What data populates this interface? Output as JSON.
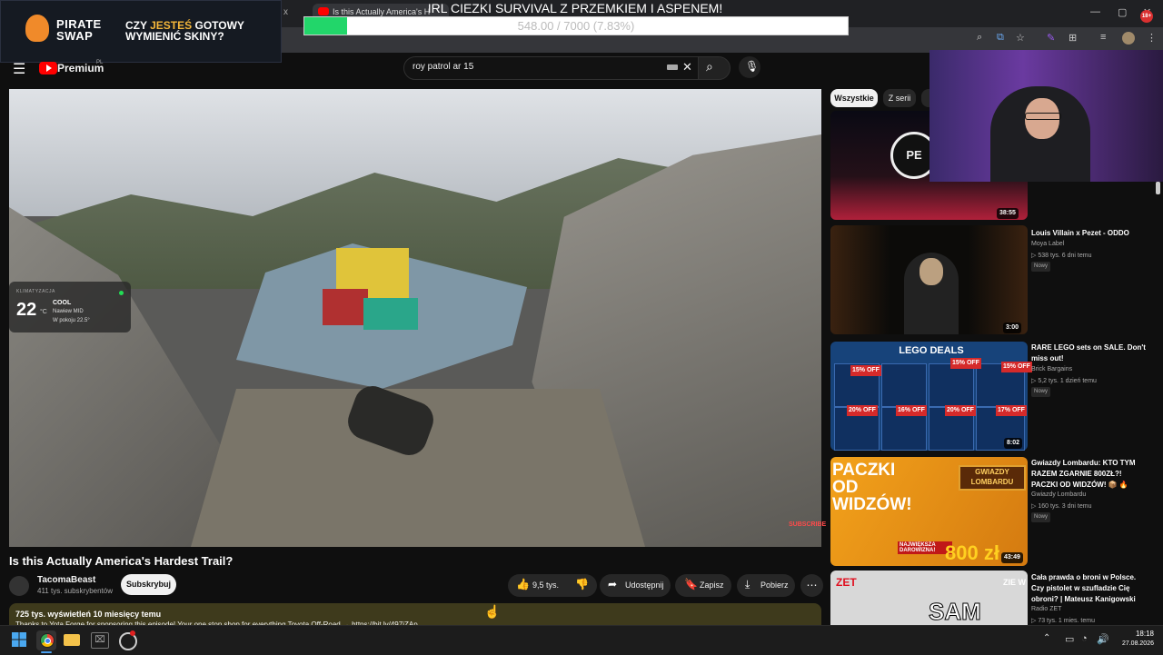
{
  "browser": {
    "tab_title": "Is this Actually America's H",
    "tab_close_left": "x",
    "window_controls": {
      "minimize": "—",
      "maximize": "▢",
      "close": "✕"
    },
    "toolbar_icons": [
      "zoom-icon",
      "install-icon",
      "bookmark-star-icon",
      "extension-icon",
      "puzzle-icon",
      "queue-icon",
      "profile-icon",
      "menu-dots-icon"
    ]
  },
  "overlay": {
    "pirate_brand": "PIRATE SWAP",
    "pirate_slogan_pre": "CZY ",
    "pirate_slogan_hl": "JESTEŚ",
    "pirate_slogan_post": " GOTOWY WYMIENIĆ SKINY?",
    "goal_title": "IRL CIEZKI SURVIVAL Z PRZEMKIEM I ASPENEM!",
    "goal_text": "548.00 / 7000 (7.83%)",
    "goal_fraction": 0.0783,
    "notification_badge": "18+"
  },
  "header": {
    "brand": "Premium",
    "brand_sup": "PL",
    "search_value": "roy patrol ar 15"
  },
  "player": {
    "climate": {
      "label": "KLIMATYZACJA",
      "temp": "22",
      "unit": "°C",
      "mode": "COOL",
      "fan": "Nawiew MID",
      "room": "W pokoju 22.5°"
    },
    "watermark": "SUBSCRIBE"
  },
  "video": {
    "title": "Is this Actually America's Hardest Trail?",
    "channel": "TacomaBeast",
    "subs": "411 tys. subskrybentów",
    "subscribe_label": "Subskrybuj",
    "likes": "9,5 tys.",
    "share_label": "Udostępnij",
    "save_label": "Zapisz",
    "download_label": "Pobierz",
    "more_label": "⋯",
    "views": "725 tys. wyświetleń  10 miesięcy temu",
    "description": "Thanks to Yota Forge for sponsoring this episode! Your one stop shop for everything Toyota Off-Road → https://bit.ly/497iZAp"
  },
  "chips": {
    "all": "Wszystkie",
    "series": "Z serii"
  },
  "sidebar": [
    {
      "duration": "38:55",
      "thumb_text": "PE"
    },
    {
      "duration": "3:00",
      "title": "Louis Villain x Pezet - ODDO",
      "channel": "Moya Label",
      "meta": "▷ 538 tys.  6 dni temu",
      "badge": "Nowy"
    },
    {
      "duration": "8:02",
      "thumb_title": "LEGO DEALS",
      "offs": [
        "15% OFF",
        "15% OFF",
        "15% OFF",
        "20% OFF",
        "16% OFF",
        "20% OFF",
        "17% OFF"
      ],
      "title": "RARE LEGO sets on SALE. Don't miss out!",
      "channel": "Brick Bargains",
      "meta": "▷ 5,2 tys.  1 dzień temu",
      "badge": "Nowy"
    },
    {
      "duration": "43:49",
      "thumb_text": "PACZKI OD WIDZÓW!",
      "thumb_badge": "GWIAZDY LOMBARDU",
      "thumb_naj": "NAJWIĘKSZA DAROWIZNA!",
      "thumb_big": "800 zł",
      "title": "Gwiazdy Lombardu: KTO TYM RAZEM ZGARNIE 800ZŁ?! PACZKI OD WIDZÓW! 📦 🔥",
      "channel": "Gwiazdy Lombardu",
      "meta": "▷ 160 tys.  3 dni temu",
      "badge": "Nowy"
    },
    {
      "thumb_zet": "ZET",
      "thumb_text": "SAM",
      "thumb_side": "ZIE W",
      "title": "Cała prawda o broni w Polsce. Czy pistolet w szufladzie Cię obroni? | Mateusz Kanigowski",
      "channel": "Radio ZET",
      "meta": "▷ 73 tys.  1 mies. temu"
    }
  ],
  "taskbar": {
    "time": "18:18",
    "date": "27.08.2026",
    "icons": [
      "windows-start-icon",
      "chrome-icon",
      "folder-icon",
      "terminal-icon",
      "obs-icon"
    ]
  }
}
